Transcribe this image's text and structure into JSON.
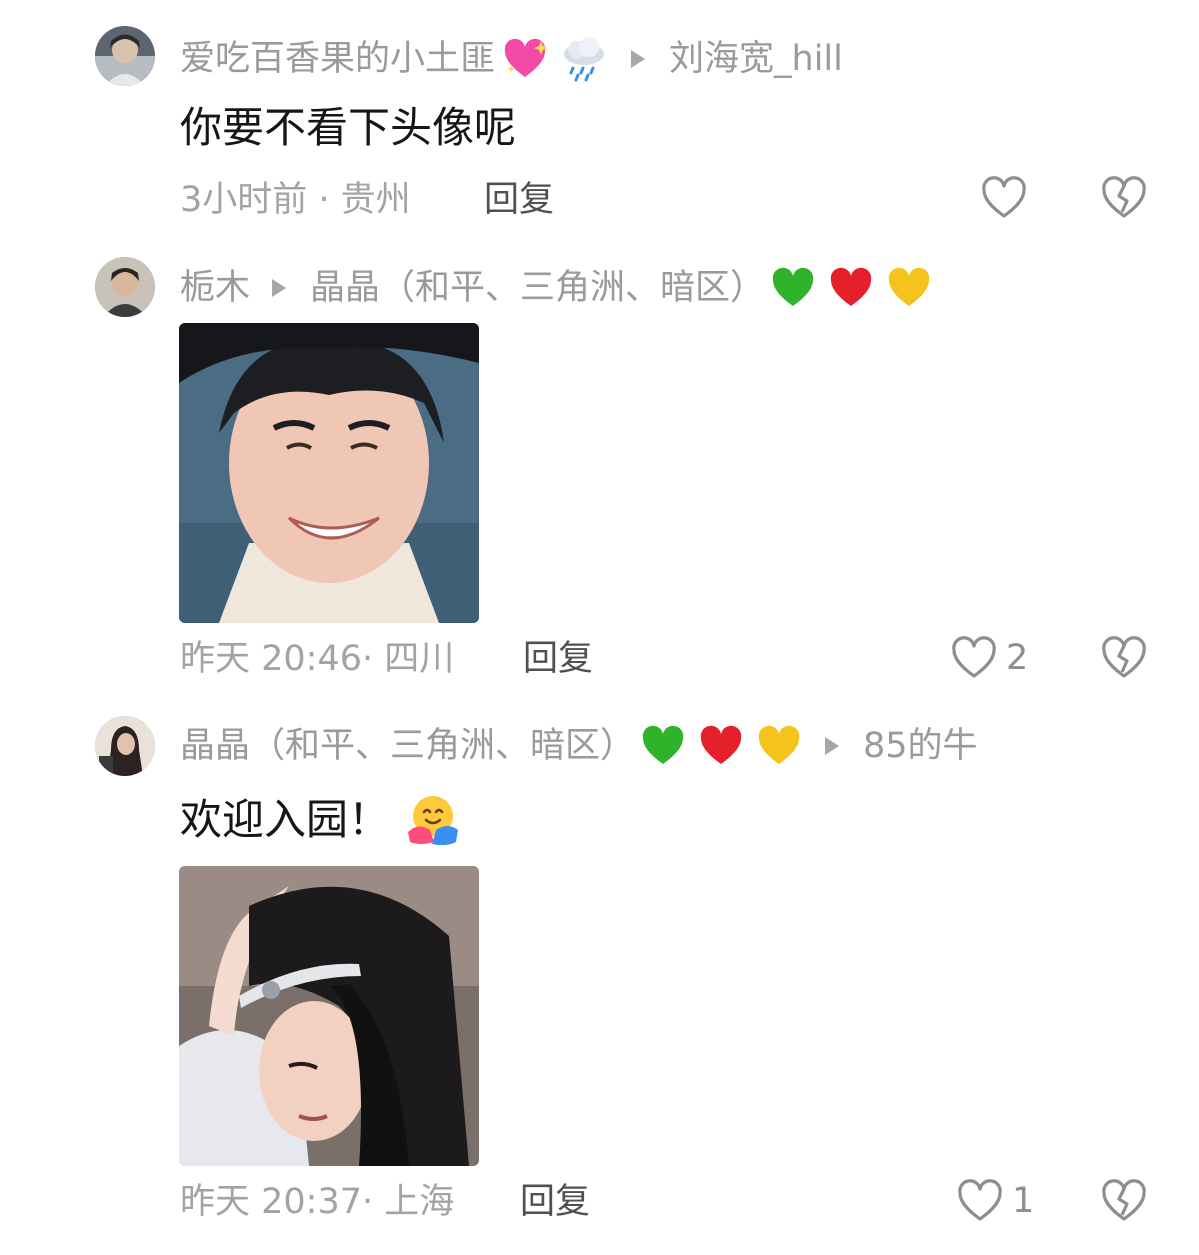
{
  "comments": [
    {
      "author": "爱吃百香果的小土匪",
      "author_emojis": [
        "sparkling-heart-icon",
        "rain-cloud-icon"
      ],
      "reply_to": "刘海宽_hill",
      "text": "你要不看下头像呢",
      "time_location": "3小时前 · 贵州",
      "reply_label": "回复",
      "likes": ""
    },
    {
      "author": "栀木",
      "reply_to": "晶晶（和平、三角洲、暗区）",
      "reply_to_emojis": [
        "green-heart-icon",
        "red-heart-icon",
        "yellow-heart-icon"
      ],
      "time_location": "昨天 20:46· 四川",
      "reply_label": "回复",
      "likes": "2"
    },
    {
      "author": "晶晶（和平、三角洲、暗区）",
      "author_emojis": [
        "green-heart-icon",
        "red-heart-icon",
        "yellow-heart-icon"
      ],
      "reply_to": "85的牛",
      "text": "欢迎入园！",
      "text_emoji": "hugging-face-icon",
      "time_location": "昨天 20:37· 上海",
      "reply_label": "回复",
      "likes": "1"
    }
  ],
  "colors": {
    "meta_text": "#a3a3a3",
    "body_text": "#161616",
    "reply_text": "#505050",
    "icon_stroke": "#8e8e8e"
  }
}
